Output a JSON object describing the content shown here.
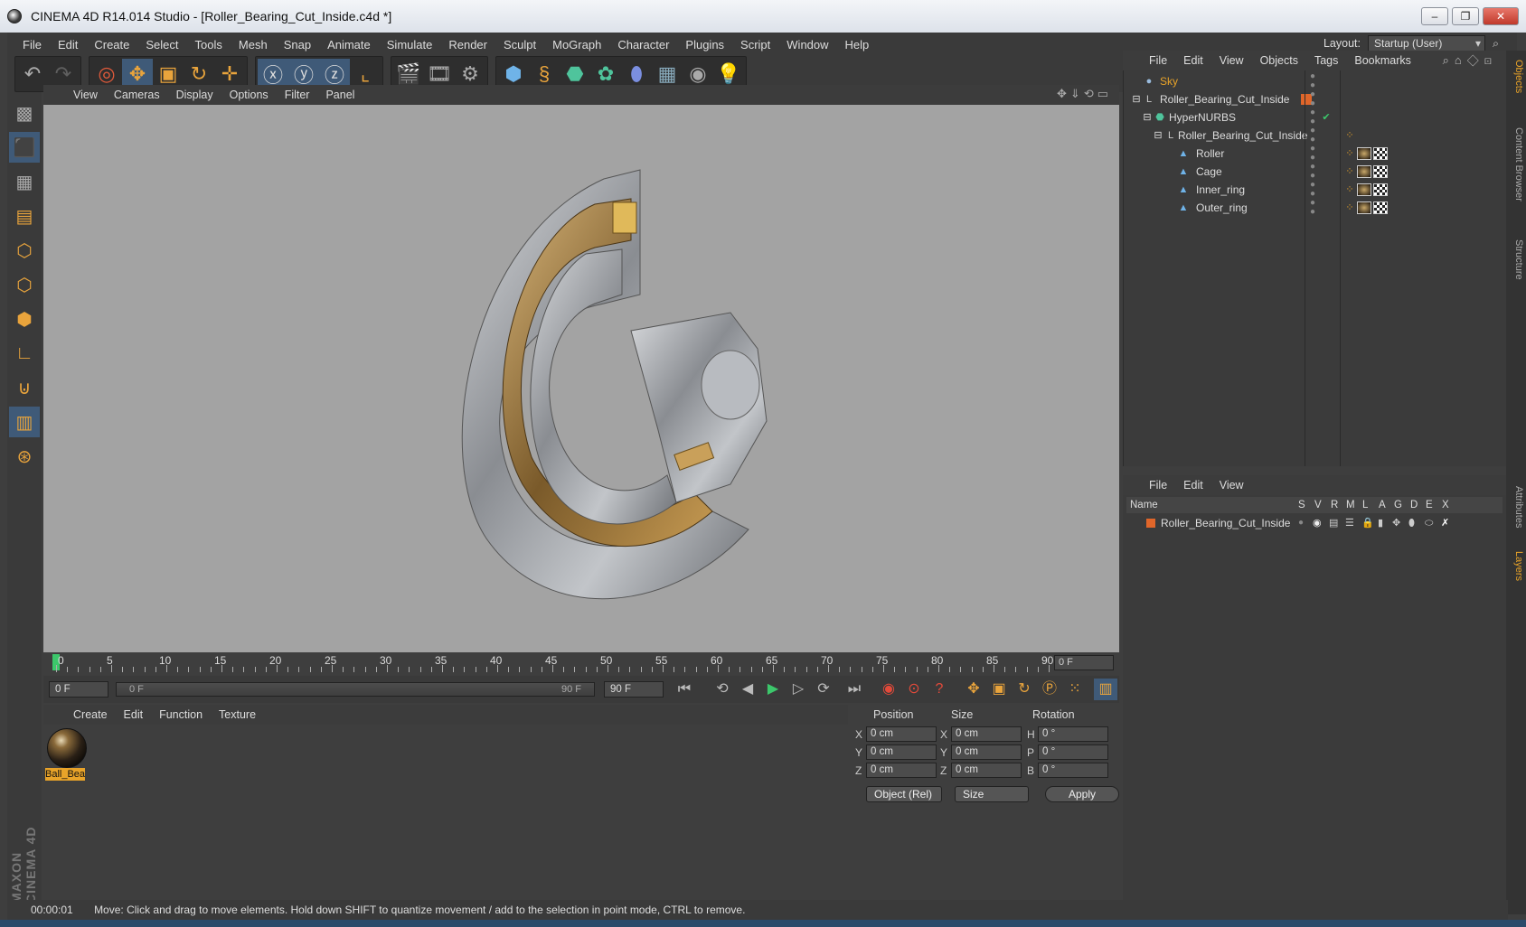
{
  "window": {
    "title": "CINEMA 4D R14.014 Studio - [Roller_Bearing_Cut_Inside.c4d *]"
  },
  "menubar": [
    "File",
    "Edit",
    "Create",
    "Select",
    "Tools",
    "Mesh",
    "Snap",
    "Animate",
    "Simulate",
    "Render",
    "Sculpt",
    "MoGraph",
    "Character",
    "Plugins",
    "Script",
    "Window",
    "Help"
  ],
  "layout": {
    "label": "Layout:",
    "value": "Startup (User)"
  },
  "viewport_menu": [
    "View",
    "Cameras",
    "Display",
    "Options",
    "Filter",
    "Panel"
  ],
  "timeline": {
    "ticks": [
      "0",
      "5",
      "10",
      "15",
      "20",
      "25",
      "30",
      "35",
      "40",
      "45",
      "50",
      "55",
      "60",
      "65",
      "70",
      "75",
      "80",
      "85",
      "90"
    ],
    "current_frame": "0 F",
    "start_field": "0 F",
    "range_start": "0 F",
    "range_end": "90 F",
    "end_field": "90 F"
  },
  "material_menu": [
    "Create",
    "Edit",
    "Function",
    "Texture"
  ],
  "material": {
    "name": "Ball_Bea"
  },
  "coords": {
    "headers": {
      "position": "Position",
      "size": "Size",
      "rotation": "Rotation"
    },
    "rows": [
      {
        "axis": "X",
        "pos": "0 cm",
        "saxis": "X",
        "size": "0 cm",
        "raxis": "H",
        "rot": "0 °"
      },
      {
        "axis": "Y",
        "pos": "0 cm",
        "saxis": "Y",
        "size": "0 cm",
        "raxis": "P",
        "rot": "0 °"
      },
      {
        "axis": "Z",
        "pos": "0 cm",
        "saxis": "Z",
        "size": "0 cm",
        "raxis": "B",
        "rot": "0 °"
      }
    ],
    "mode": "Object (Rel)",
    "size_mode": "Size",
    "apply": "Apply"
  },
  "objects_menu": [
    "File",
    "Edit",
    "View",
    "Objects",
    "Tags",
    "Bookmarks"
  ],
  "objects": [
    {
      "name": "Sky"
    },
    {
      "name": "Roller_Bearing_Cut_Inside"
    },
    {
      "name": "HyperNURBS"
    },
    {
      "name": "Roller_Bearing_Cut_Inside"
    },
    {
      "name": "Roller"
    },
    {
      "name": "Cage"
    },
    {
      "name": "Inner_ring"
    },
    {
      "name": "Outer_ring"
    }
  ],
  "layers_menu": [
    "File",
    "Edit",
    "View"
  ],
  "layers": {
    "columns": {
      "name": "Name",
      "s": "S",
      "v": "V",
      "r": "R",
      "m": "M",
      "l": "L",
      "a": "A",
      "g": "G",
      "d": "D",
      "e": "E",
      "x": "X"
    },
    "row": "Roller_Bearing_Cut_Inside"
  },
  "side_tabs": [
    "Objects",
    "Content Browser",
    "Structure",
    "Attributes",
    "Layers"
  ],
  "maxon_logo": "MAXON CINEMA 4D",
  "status": {
    "time": "00:00:01",
    "message": "Move: Click and drag to move elements. Hold down SHIFT to quantize movement / add to the selection in point mode, CTRL to remove."
  },
  "colors": {
    "accent": "#e8a329",
    "viewport_bg": "#a3a3a3",
    "panel_bg": "#3e3e3e"
  }
}
